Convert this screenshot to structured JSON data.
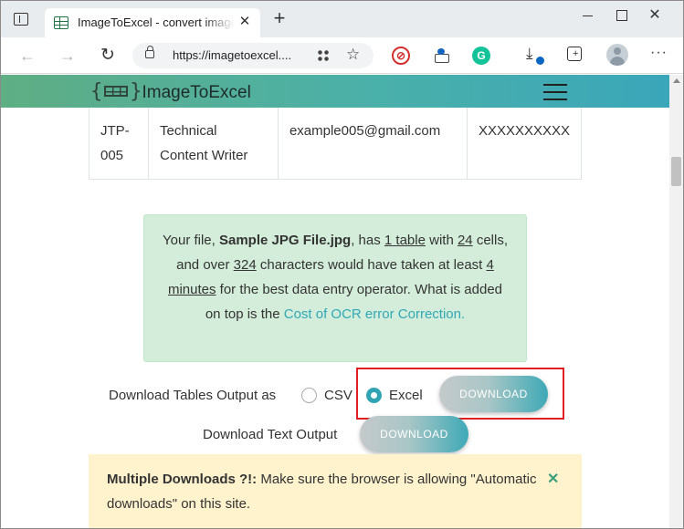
{
  "browser": {
    "tab_title": "ImageToExcel - convert image to",
    "tab_close": "✕",
    "new_tab": "+",
    "url": "https://imagetoexcel....",
    "win_close": "✕",
    "menu": "···"
  },
  "site": {
    "brand_name": "ImageToExcel"
  },
  "table": {
    "row": [
      "JTP-005",
      "Technical Content Writer",
      "example005@gmail.com",
      "XXXXXXXXXX"
    ]
  },
  "info": {
    "text_1": "Your file, ",
    "file_name": "Sample JPG File.jpg",
    "text_2": ", has ",
    "table_count": "1 table",
    "text_3": " with ",
    "cell_count": "24",
    "text_4": " cells, and over ",
    "char_count": "324",
    "text_5": " characters would have taken at least ",
    "duration": "4 minutes",
    "text_6": " for the best data entry operator. What is added on top is the ",
    "link": "Cost of OCR error Correction."
  },
  "download": {
    "tables_label": "Download Tables Output as",
    "csv_label": "CSV",
    "excel_label": "Excel",
    "selected": "Excel",
    "button_label": "DOWNLOAD",
    "text_label": "Download Text Output",
    "text_button_label": "DOWNLOAD"
  },
  "alert": {
    "title": "Multiple Downloads ?!:",
    "message": " Make sure the browser is allowing \"Automatic downloads\" on this site.",
    "close": "✕"
  },
  "colors": {
    "header_start": "#5fae84",
    "header_end": "#3aa6b9",
    "info_bg": "#d4edda",
    "alert_bg": "#fff3cd",
    "accent": "#30a4b4",
    "highlight": "#e02020"
  }
}
